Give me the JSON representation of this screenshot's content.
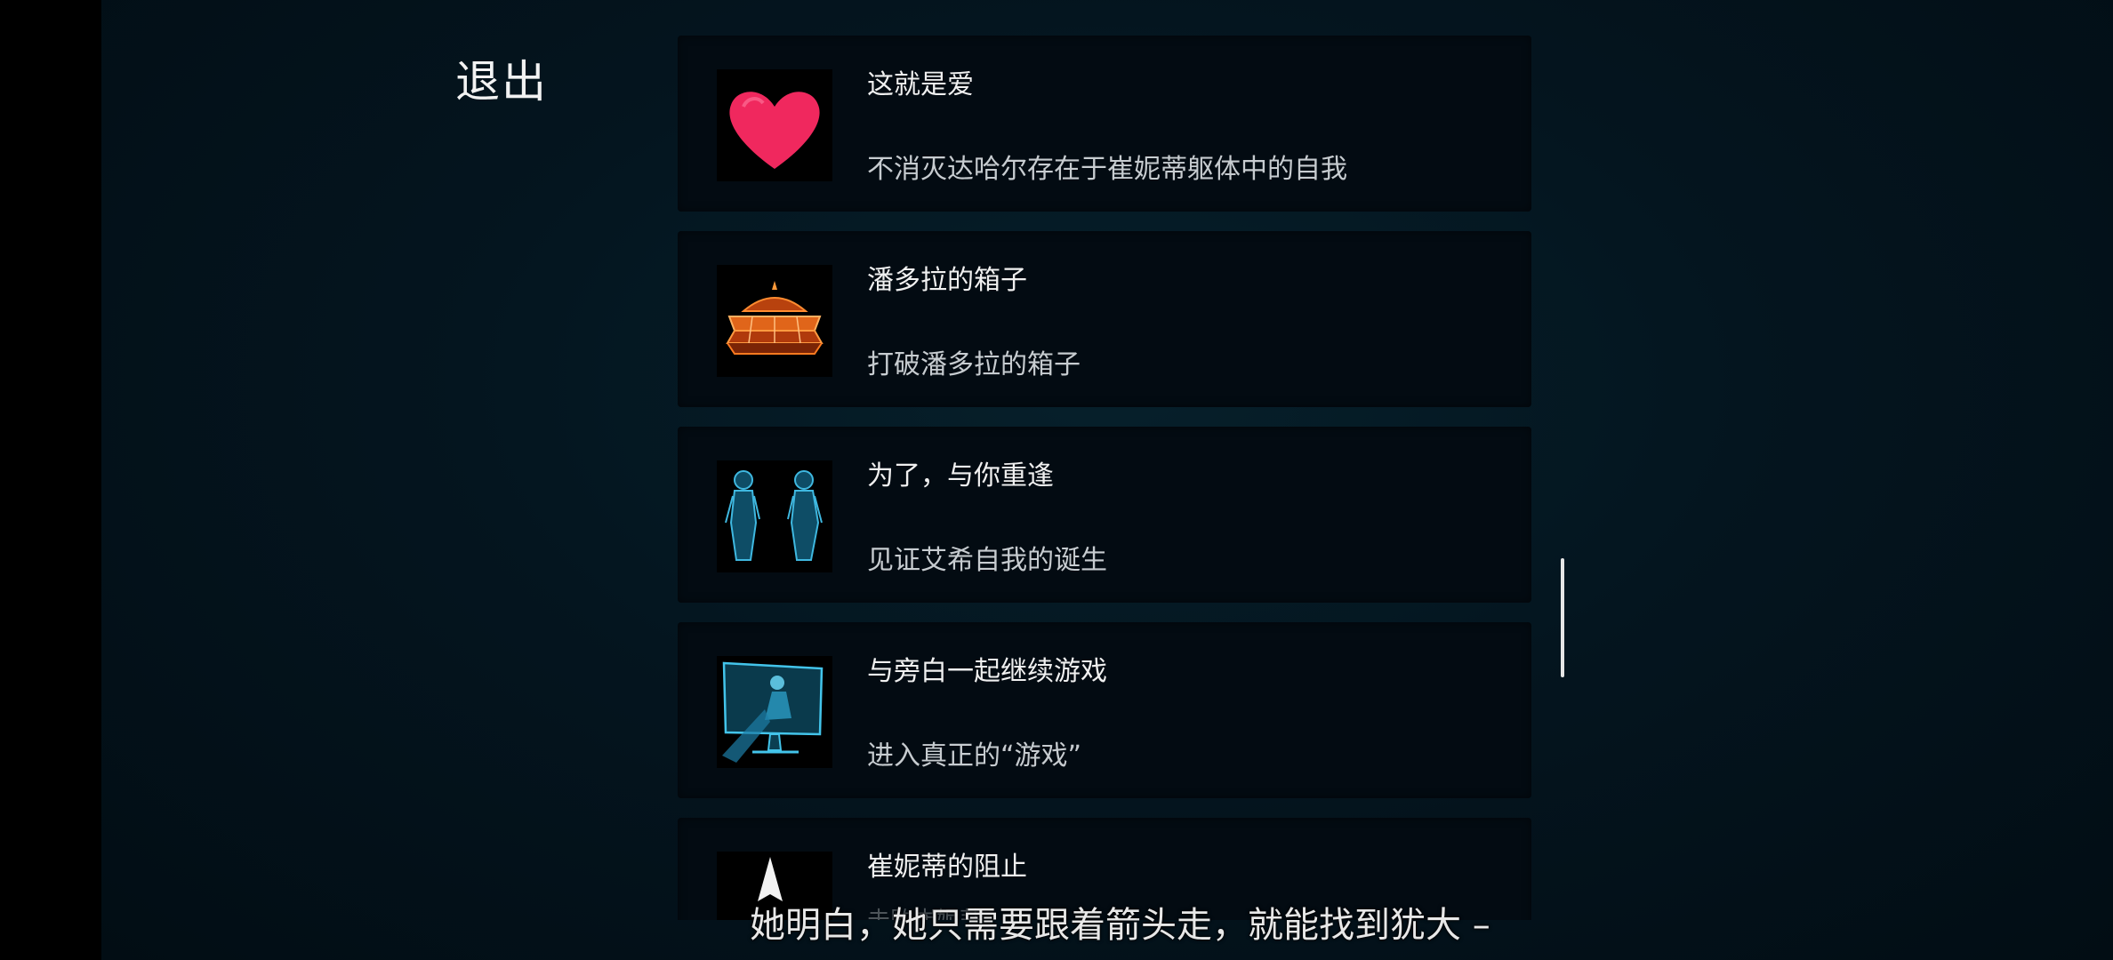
{
  "menu": {
    "exit_label": "退出"
  },
  "achievements": [
    {
      "title": "这就是爱",
      "description": "不消灭达哈尔存在于崔妮蒂躯体中的自我",
      "icon": "heart-icon"
    },
    {
      "title": "潘多拉的箱子",
      "description": "打破潘多拉的箱子",
      "icon": "pandora-box-icon"
    },
    {
      "title": "为了，与你重逢",
      "description": "见证艾希自我的诞生",
      "icon": "twin-figures-icon"
    },
    {
      "title": "与旁白一起继续游戏",
      "description": "进入真正的“游戏”",
      "icon": "monitor-figure-icon"
    },
    {
      "title": "崔妮蒂的阻止",
      "description": "击败崔妮蒂",
      "icon": "arrow-marker-icon"
    }
  ],
  "subtitle": "她明白，她只需要跟着箭头走，就能找到犹大 –"
}
